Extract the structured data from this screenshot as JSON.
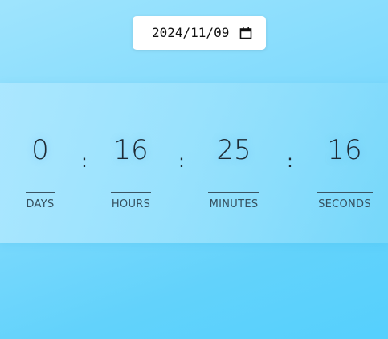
{
  "date_input": {
    "value": "2024/11/09",
    "icon": "calendar-icon"
  },
  "countdown": {
    "separator": ":",
    "units": [
      {
        "value": "0",
        "label": "DAYS"
      },
      {
        "value": "16",
        "label": "HOURS"
      },
      {
        "value": "25",
        "label": "MINUTES"
      },
      {
        "value": "16",
        "label": "SECONDS"
      }
    ]
  },
  "colors": {
    "background_start": "#9fe4fd",
    "background_end": "#55d0fd",
    "text": "#1e2a33",
    "label": "#36505e"
  }
}
